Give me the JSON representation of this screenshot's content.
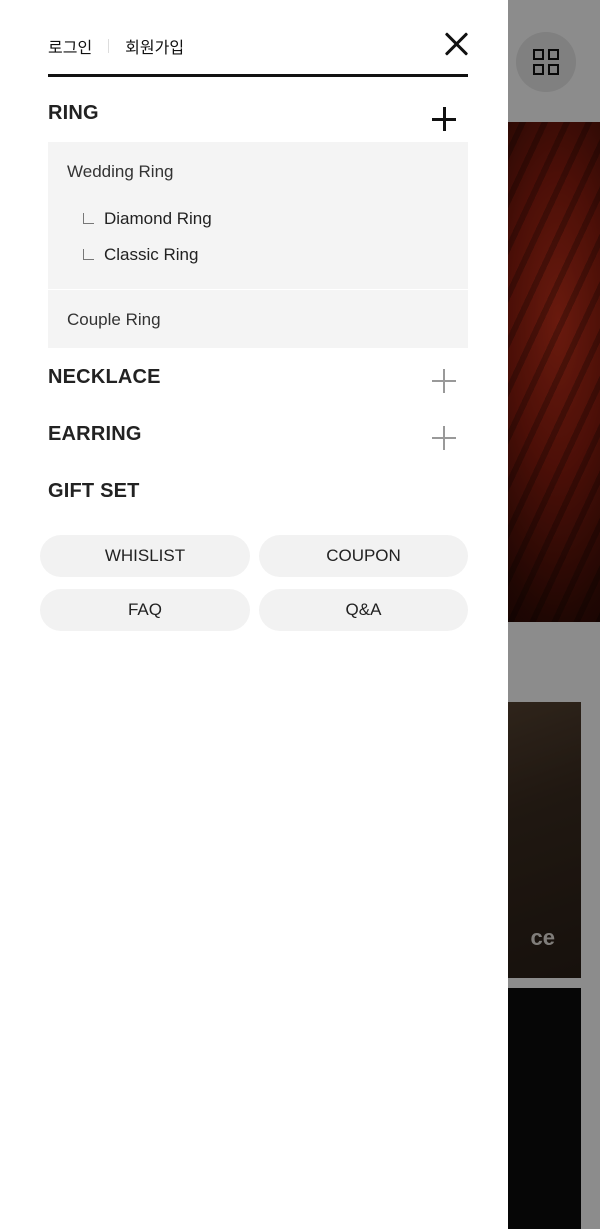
{
  "background": {
    "card_text": "ce"
  },
  "header": {
    "login_label": "로그인",
    "signup_label": "회원가입"
  },
  "menu": {
    "ring": {
      "label": "RING",
      "subitems": [
        {
          "label": "Wedding Ring",
          "children": [
            "Diamond Ring",
            "Classic Ring"
          ]
        },
        {
          "label": "Couple Ring"
        }
      ]
    },
    "necklace": {
      "label": "NECKLACE"
    },
    "earring": {
      "label": "EARRING"
    },
    "giftset": {
      "label": "GIFT SET"
    }
  },
  "quick_links": [
    "WHISLIST",
    "COUPON",
    "FAQ",
    "Q&A"
  ],
  "icons": {
    "close": "close-icon",
    "expand": "plus-icon",
    "child": "corner-l-icon",
    "grid": "grid-icon"
  }
}
